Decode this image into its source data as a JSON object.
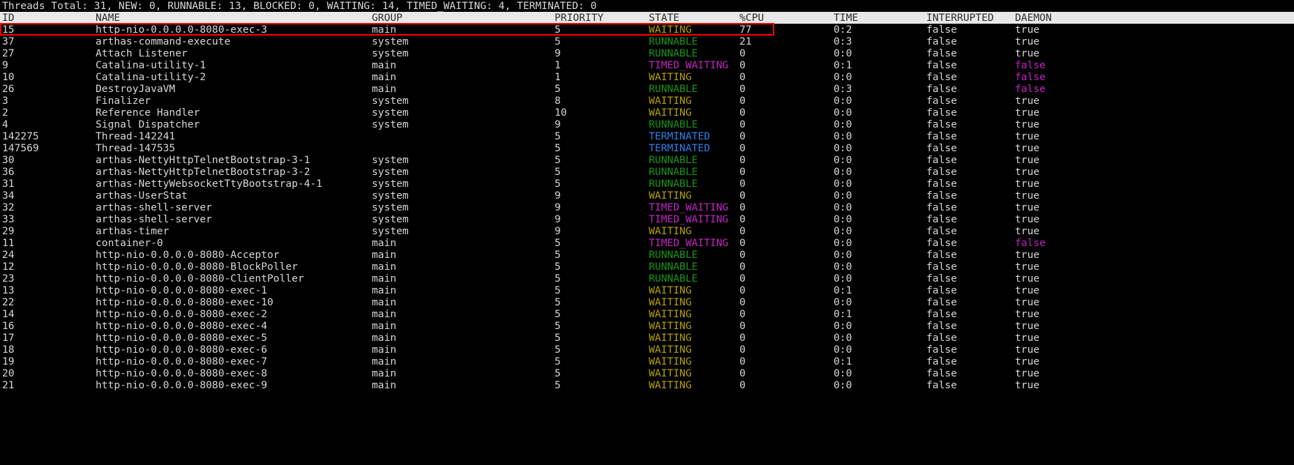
{
  "summary": {
    "text": "Threads Total: 31, NEW: 0, RUNNABLE: 13, BLOCKED: 0, WAITING: 14, TIMED_WAITING: 4, TERMINATED: 0",
    "total": 31,
    "new": 0,
    "runnable": 13,
    "blocked": 0,
    "waiting": 14,
    "timed_waiting": 4,
    "terminated": 0
  },
  "colors": {
    "background": "#000000",
    "foreground": "#d8d8d8",
    "header_bg": "#e8e8e8",
    "header_fg": "#2b2b2b",
    "highlight_border": "#ff0000",
    "state_waiting": "#b5a000",
    "state_runnable": "#1a9419",
    "state_timed_waiting": "#c423c4",
    "state_terminated": "#2e7fec",
    "daemon_false": "#c423c4"
  },
  "columns": [
    {
      "key": "id",
      "label": "ID"
    },
    {
      "key": "name",
      "label": "NAME"
    },
    {
      "key": "group",
      "label": "GROUP"
    },
    {
      "key": "priority",
      "label": "PRIORITY"
    },
    {
      "key": "state",
      "label": "STATE"
    },
    {
      "key": "cpu",
      "label": "%CPU"
    },
    {
      "key": "time",
      "label": "TIME"
    },
    {
      "key": "interrupted",
      "label": "INTERRUPTED"
    },
    {
      "key": "daemon",
      "label": "DAEMON"
    }
  ],
  "highlighted_row_index": 0,
  "rows": [
    {
      "id": "15",
      "name": "http-nio-0.0.0.0-8080-exec-3",
      "group": "main",
      "priority": "5",
      "state": "WAITING",
      "cpu": "77",
      "time": "0:2",
      "interrupted": "false",
      "daemon": "true"
    },
    {
      "id": "37",
      "name": "arthas-command-execute",
      "group": "system",
      "priority": "5",
      "state": "RUNNABLE",
      "cpu": "21",
      "time": "0:3",
      "interrupted": "false",
      "daemon": "true"
    },
    {
      "id": "27",
      "name": "Attach Listener",
      "group": "system",
      "priority": "9",
      "state": "RUNNABLE",
      "cpu": "0",
      "time": "0:0",
      "interrupted": "false",
      "daemon": "true"
    },
    {
      "id": "9",
      "name": "Catalina-utility-1",
      "group": "main",
      "priority": "1",
      "state": "TIMED_WAITING",
      "cpu": "0",
      "time": "0:1",
      "interrupted": "false",
      "daemon": "false"
    },
    {
      "id": "10",
      "name": "Catalina-utility-2",
      "group": "main",
      "priority": "1",
      "state": "WAITING",
      "cpu": "0",
      "time": "0:0",
      "interrupted": "false",
      "daemon": "false"
    },
    {
      "id": "26",
      "name": "DestroyJavaVM",
      "group": "main",
      "priority": "5",
      "state": "RUNNABLE",
      "cpu": "0",
      "time": "0:3",
      "interrupted": "false",
      "daemon": "false"
    },
    {
      "id": "3",
      "name": "Finalizer",
      "group": "system",
      "priority": "8",
      "state": "WAITING",
      "cpu": "0",
      "time": "0:0",
      "interrupted": "false",
      "daemon": "true"
    },
    {
      "id": "2",
      "name": "Reference Handler",
      "group": "system",
      "priority": "10",
      "state": "WAITING",
      "cpu": "0",
      "time": "0:0",
      "interrupted": "false",
      "daemon": "true"
    },
    {
      "id": "4",
      "name": "Signal Dispatcher",
      "group": "system",
      "priority": "9",
      "state": "RUNNABLE",
      "cpu": "0",
      "time": "0:0",
      "interrupted": "false",
      "daemon": "true"
    },
    {
      "id": "142275",
      "name": "Thread-142241",
      "group": "",
      "priority": "5",
      "state": "TERMINATED",
      "cpu": "0",
      "time": "0:0",
      "interrupted": "false",
      "daemon": "true"
    },
    {
      "id": "147569",
      "name": "Thread-147535",
      "group": "",
      "priority": "5",
      "state": "TERMINATED",
      "cpu": "0",
      "time": "0:0",
      "interrupted": "false",
      "daemon": "true"
    },
    {
      "id": "30",
      "name": "arthas-NettyHttpTelnetBootstrap-3-1",
      "group": "system",
      "priority": "5",
      "state": "RUNNABLE",
      "cpu": "0",
      "time": "0:0",
      "interrupted": "false",
      "daemon": "true"
    },
    {
      "id": "36",
      "name": "arthas-NettyHttpTelnetBootstrap-3-2",
      "group": "system",
      "priority": "5",
      "state": "RUNNABLE",
      "cpu": "0",
      "time": "0:0",
      "interrupted": "false",
      "daemon": "true"
    },
    {
      "id": "31",
      "name": "arthas-NettyWebsocketTtyBootstrap-4-1",
      "group": "system",
      "priority": "5",
      "state": "RUNNABLE",
      "cpu": "0",
      "time": "0:0",
      "interrupted": "false",
      "daemon": "true"
    },
    {
      "id": "34",
      "name": "arthas-UserStat",
      "group": "system",
      "priority": "9",
      "state": "WAITING",
      "cpu": "0",
      "time": "0:0",
      "interrupted": "false",
      "daemon": "true"
    },
    {
      "id": "32",
      "name": "arthas-shell-server",
      "group": "system",
      "priority": "9",
      "state": "TIMED_WAITING",
      "cpu": "0",
      "time": "0:0",
      "interrupted": "false",
      "daemon": "true"
    },
    {
      "id": "33",
      "name": "arthas-shell-server",
      "group": "system",
      "priority": "9",
      "state": "TIMED_WAITING",
      "cpu": "0",
      "time": "0:0",
      "interrupted": "false",
      "daemon": "true"
    },
    {
      "id": "29",
      "name": "arthas-timer",
      "group": "system",
      "priority": "9",
      "state": "WAITING",
      "cpu": "0",
      "time": "0:0",
      "interrupted": "false",
      "daemon": "true"
    },
    {
      "id": "11",
      "name": "container-0",
      "group": "main",
      "priority": "5",
      "state": "TIMED_WAITING",
      "cpu": "0",
      "time": "0:0",
      "interrupted": "false",
      "daemon": "false"
    },
    {
      "id": "24",
      "name": "http-nio-0.0.0.0-8080-Acceptor",
      "group": "main",
      "priority": "5",
      "state": "RUNNABLE",
      "cpu": "0",
      "time": "0:0",
      "interrupted": "false",
      "daemon": "true"
    },
    {
      "id": "12",
      "name": "http-nio-0.0.0.0-8080-BlockPoller",
      "group": "main",
      "priority": "5",
      "state": "RUNNABLE",
      "cpu": "0",
      "time": "0:0",
      "interrupted": "false",
      "daemon": "true"
    },
    {
      "id": "23",
      "name": "http-nio-0.0.0.0-8080-ClientPoller",
      "group": "main",
      "priority": "5",
      "state": "RUNNABLE",
      "cpu": "0",
      "time": "0:0",
      "interrupted": "false",
      "daemon": "true"
    },
    {
      "id": "13",
      "name": "http-nio-0.0.0.0-8080-exec-1",
      "group": "main",
      "priority": "5",
      "state": "WAITING",
      "cpu": "0",
      "time": "0:1",
      "interrupted": "false",
      "daemon": "true"
    },
    {
      "id": "22",
      "name": "http-nio-0.0.0.0-8080-exec-10",
      "group": "main",
      "priority": "5",
      "state": "WAITING",
      "cpu": "0",
      "time": "0:0",
      "interrupted": "false",
      "daemon": "true"
    },
    {
      "id": "14",
      "name": "http-nio-0.0.0.0-8080-exec-2",
      "group": "main",
      "priority": "5",
      "state": "WAITING",
      "cpu": "0",
      "time": "0:1",
      "interrupted": "false",
      "daemon": "true"
    },
    {
      "id": "16",
      "name": "http-nio-0.0.0.0-8080-exec-4",
      "group": "main",
      "priority": "5",
      "state": "WAITING",
      "cpu": "0",
      "time": "0:0",
      "interrupted": "false",
      "daemon": "true"
    },
    {
      "id": "17",
      "name": "http-nio-0.0.0.0-8080-exec-5",
      "group": "main",
      "priority": "5",
      "state": "WAITING",
      "cpu": "0",
      "time": "0:0",
      "interrupted": "false",
      "daemon": "true"
    },
    {
      "id": "18",
      "name": "http-nio-0.0.0.0-8080-exec-6",
      "group": "main",
      "priority": "5",
      "state": "WAITING",
      "cpu": "0",
      "time": "0:0",
      "interrupted": "false",
      "daemon": "true"
    },
    {
      "id": "19",
      "name": "http-nio-0.0.0.0-8080-exec-7",
      "group": "main",
      "priority": "5",
      "state": "WAITING",
      "cpu": "0",
      "time": "0:1",
      "interrupted": "false",
      "daemon": "true"
    },
    {
      "id": "20",
      "name": "http-nio-0.0.0.0-8080-exec-8",
      "group": "main",
      "priority": "5",
      "state": "WAITING",
      "cpu": "0",
      "time": "0:0",
      "interrupted": "false",
      "daemon": "true"
    },
    {
      "id": "21",
      "name": "http-nio-0.0.0.0-8080-exec-9",
      "group": "main",
      "priority": "5",
      "state": "WAITING",
      "cpu": "0",
      "time": "0:0",
      "interrupted": "false",
      "daemon": "true"
    }
  ]
}
